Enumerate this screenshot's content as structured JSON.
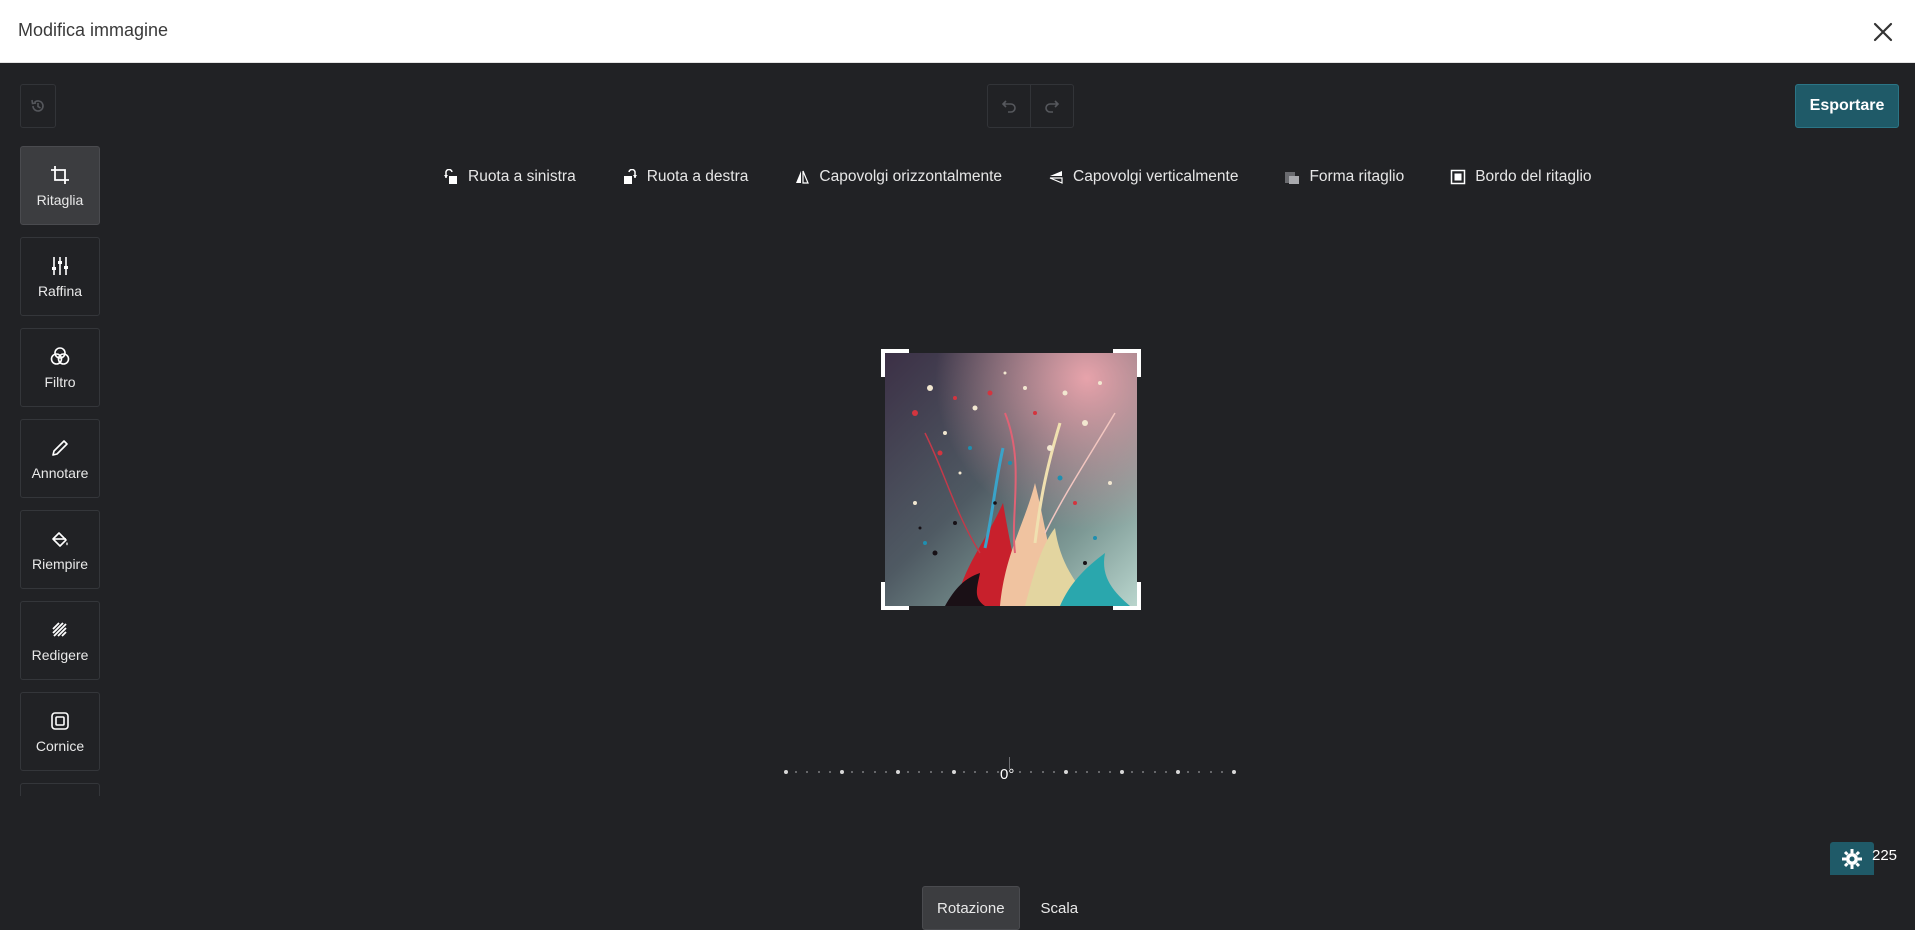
{
  "window": {
    "title": "Modifica immagine"
  },
  "header": {
    "export_label": "Esportare"
  },
  "tools": [
    {
      "label": "Ritaglia",
      "icon": "crop-icon",
      "active": true
    },
    {
      "label": "Raffina",
      "icon": "sliders-icon"
    },
    {
      "label": "Filtro",
      "icon": "filter-circles-icon"
    },
    {
      "label": "Annotare",
      "icon": "pencil-icon"
    },
    {
      "label": "Riempire",
      "icon": "paint-bucket-icon"
    },
    {
      "label": "Redigere",
      "icon": "redact-hatch-icon"
    },
    {
      "label": "Cornice",
      "icon": "frame-icon"
    }
  ],
  "crop_actions": [
    {
      "label": "Ruota a sinistra",
      "icon": "rotate-left-icon"
    },
    {
      "label": "Ruota a destra",
      "icon": "rotate-right-icon"
    },
    {
      "label": "Capovolgi orizzontalmente",
      "icon": "flip-horizontal-icon"
    },
    {
      "label": "Capovolgi verticalmente",
      "icon": "flip-vertical-icon"
    },
    {
      "label": "Forma ritaglio",
      "icon": "crop-shape-icon"
    },
    {
      "label": "Bordo del ritaglio",
      "icon": "crop-border-icon"
    }
  ],
  "rotation": {
    "value_label": "0°"
  },
  "mode_tabs": [
    {
      "label": "Rotazione",
      "active": true
    },
    {
      "label": "Scala",
      "active": false
    }
  ],
  "corner": {
    "number": "225"
  },
  "colors": {
    "accent": "#1f5a68",
    "background": "#212225",
    "panel_border": "#34363a"
  }
}
